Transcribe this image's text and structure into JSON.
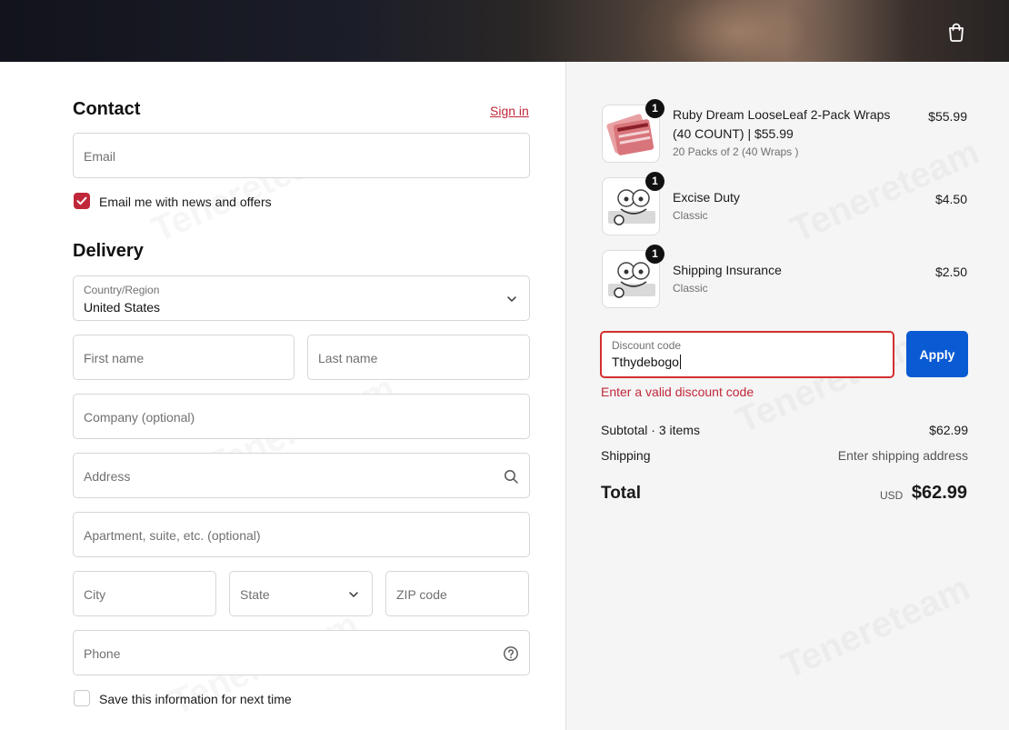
{
  "header": {
    "cart_icon": "shopping-bag-icon"
  },
  "contact": {
    "title": "Contact",
    "sign_in": "Sign in",
    "email_placeholder": "Email",
    "newsletter_label": "Email me with news and offers",
    "newsletter_checked": true
  },
  "delivery": {
    "title": "Delivery",
    "country_label": "Country/Region",
    "country_value": "United States",
    "first_name": "First name",
    "last_name": "Last name",
    "company": "Company (optional)",
    "address": "Address",
    "apartment": "Apartment, suite, etc. (optional)",
    "city": "City",
    "state": "State",
    "zip": "ZIP code",
    "phone": "Phone",
    "save_info_label": "Save this information for next time",
    "save_info_checked": false
  },
  "cart": {
    "items": [
      {
        "name": "Ruby Dream LooseLeaf 2-Pack Wraps (40 COUNT) | $55.99",
        "variant": "20 Packs of 2 (40 Wraps )",
        "price": "$55.99",
        "qty": "1"
      },
      {
        "name": "Excise Duty",
        "variant": "Classic",
        "price": "$4.50",
        "qty": "1"
      },
      {
        "name": "Shipping Insurance",
        "variant": "Classic",
        "price": "$2.50",
        "qty": "1"
      }
    ]
  },
  "discount": {
    "label": "Discount code",
    "value": "Tthydebogo",
    "apply_label": "Apply",
    "error": "Enter a valid discount code"
  },
  "summary": {
    "subtotal_label": "Subtotal · 3 items",
    "subtotal_value": "$62.99",
    "shipping_label": "Shipping",
    "shipping_value": "Enter shipping address",
    "total_label": "Total",
    "currency": "USD",
    "total_value": "$62.99"
  },
  "colors": {
    "accent": "#c0283a",
    "primary_button": "#0a5bd3",
    "error_border": "#d32f2f"
  }
}
